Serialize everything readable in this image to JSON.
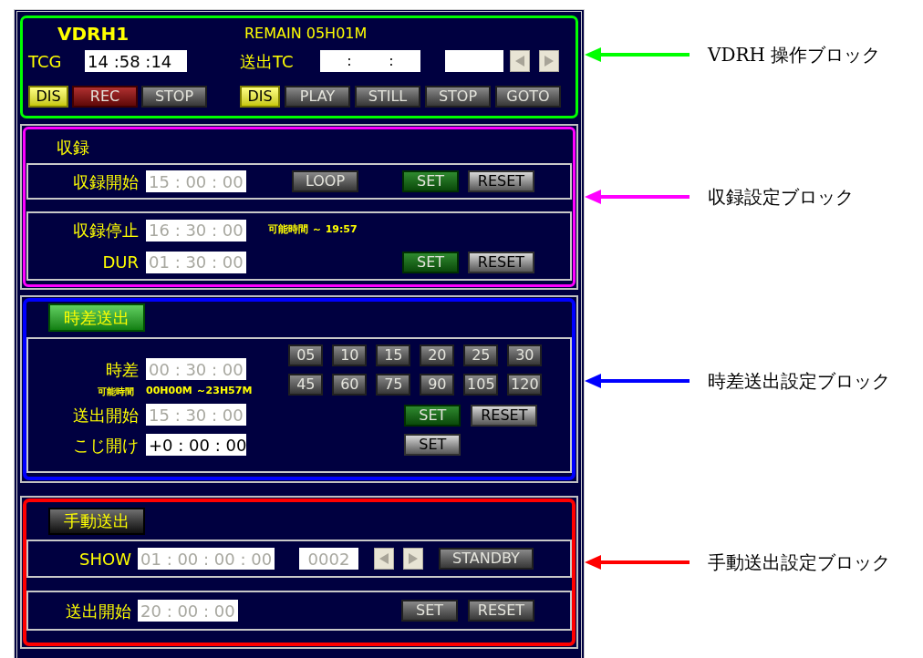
{
  "vdrh": {
    "title": "VDRH1",
    "remain": "REMAIN 05H01M",
    "tcg_label": "TCG",
    "tcg": {
      "value": "14 :58 :14",
      "disabled": false
    },
    "send_tc_label": "送出TC",
    "send_tc": {
      "value": ":        :",
      "disabled": false
    },
    "rec_buttons": [
      {
        "label": "DIS",
        "kind": "dis",
        "disabled": false
      },
      {
        "label": "REC",
        "kind": "rec",
        "disabled": true
      },
      {
        "label": "STOP",
        "kind": "plain",
        "disabled": true
      }
    ],
    "play_buttons": [
      {
        "label": "DIS",
        "kind": "dis",
        "disabled": false
      },
      {
        "label": "PLAY",
        "kind": "plain",
        "disabled": true
      },
      {
        "label": "STILL",
        "kind": "plain",
        "disabled": true
      },
      {
        "label": "STOP",
        "kind": "plain",
        "disabled": true
      },
      {
        "label": "GOTO",
        "kind": "plain",
        "disabled": true
      }
    ]
  },
  "recording": {
    "title": "収録",
    "start_label": "収録開始",
    "start": {
      "value": "15 : 00 : 00",
      "disabled": true
    },
    "loop": {
      "label": "LOOP",
      "kind": "plain",
      "disabled": true
    },
    "start_set": {
      "label": "SET",
      "kind": "go",
      "disabled": true
    },
    "start_reset": {
      "label": "RESET",
      "kind": "plain",
      "disabled": false
    },
    "stop_label": "収録停止",
    "stop": {
      "value": "16 : 30 : 00",
      "disabled": true
    },
    "note": "可能時間 ～ 19:57",
    "dur_label": "DUR",
    "dur": {
      "value": "01 : 30 : 00",
      "disabled": true
    },
    "dur_set": {
      "label": "SET",
      "kind": "go",
      "disabled": true
    },
    "dur_reset": {
      "label": "RESET",
      "kind": "plain",
      "disabled": false
    }
  },
  "timediff": {
    "tab": {
      "label": "時差送出",
      "kind": "go",
      "disabled": false
    },
    "diff_label": "時差",
    "diff": {
      "value": "00 : 30 : 00",
      "disabled": true
    },
    "note_label": "可能時間",
    "note_value": "00H00M ～23H57M",
    "presets": [
      {
        "label": "05",
        "disabled": true
      },
      {
        "label": "10",
        "disabled": true
      },
      {
        "label": "15",
        "disabled": true
      },
      {
        "label": "20",
        "disabled": true
      },
      {
        "label": "25",
        "disabled": true
      },
      {
        "label": "30",
        "disabled": true
      },
      {
        "label": "45",
        "disabled": true
      },
      {
        "label": "60",
        "disabled": true
      },
      {
        "label": "75",
        "disabled": true
      },
      {
        "label": "90",
        "disabled": true
      },
      {
        "label": "105",
        "disabled": true
      },
      {
        "label": "120",
        "disabled": true
      }
    ],
    "send_label": "送出開始",
    "send": {
      "value": "15 : 30 : 00",
      "disabled": true
    },
    "send_set": {
      "label": "SET",
      "kind": "go",
      "disabled": true
    },
    "send_reset": {
      "label": "RESET",
      "kind": "plain",
      "disabled": false
    },
    "koji_label": "こじ開け",
    "koji": {
      "value": "+0 : 00 : 00",
      "disabled": false
    },
    "koji_set": {
      "label": "SET",
      "kind": "plain",
      "disabled": false
    }
  },
  "manual": {
    "tab": {
      "label": "手動送出",
      "kind": "dark",
      "disabled": false
    },
    "show_label": "SHOW",
    "show": {
      "value": "01 : 00 : 00 : 00",
      "disabled": true
    },
    "count": {
      "value": "0002",
      "disabled": true
    },
    "standby": {
      "label": "STANDBY",
      "kind": "plain",
      "disabled": true
    },
    "send_label": "送出開始",
    "send": {
      "value": "20 : 00 : 00",
      "disabled": true
    },
    "send_set": {
      "label": "SET",
      "kind": "plain",
      "disabled": true
    },
    "send_reset": {
      "label": "RESET",
      "kind": "plain",
      "disabled": true
    }
  },
  "annotations": [
    {
      "label": "VDRH 操作ブロック",
      "color": "#00ff00"
    },
    {
      "label": "収録設定ブロック",
      "color": "#ff00ff"
    },
    {
      "label": "時差送出設定ブロック",
      "color": "#0000ff"
    },
    {
      "label": "手動送出設定ブロック",
      "color": "#ff0000"
    }
  ]
}
